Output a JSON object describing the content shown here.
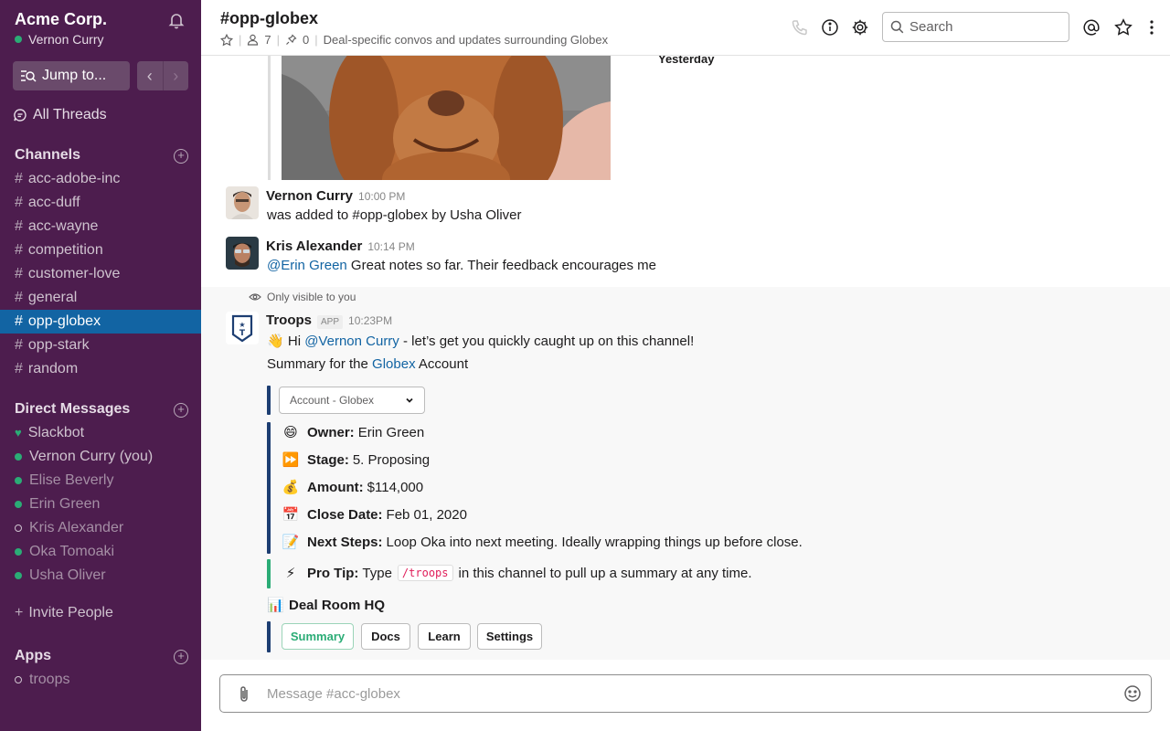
{
  "workspace": {
    "name": "Acme Corp.",
    "user": "Vernon Curry"
  },
  "sidebar": {
    "jump_label": "Jump to...",
    "threads_label": "All Threads",
    "channels_title": "Channels",
    "channels": [
      "acc-adobe-inc",
      "acc-duff",
      "acc-wayne",
      "competition",
      "customer-love",
      "general",
      "opp-globex",
      "opp-stark",
      "random"
    ],
    "active_channel": "opp-globex",
    "dm_title": "Direct Messages",
    "dms": [
      {
        "name": "Slackbot",
        "status": "bot"
      },
      {
        "name": "Vernon Curry  (you)",
        "status": "active"
      },
      {
        "name": "Elise Beverly",
        "status": "active-dim"
      },
      {
        "name": "Erin Green",
        "status": "active-dim"
      },
      {
        "name": "Kris Alexander",
        "status": "away"
      },
      {
        "name": "Oka Tomoaki",
        "status": "active-dim"
      },
      {
        "name": "Usha Oliver",
        "status": "active-dim"
      }
    ],
    "invite_label": "Invite People",
    "apps_title": "Apps",
    "apps": [
      "troops"
    ]
  },
  "header": {
    "channel": "#opp-globex",
    "members": "7",
    "pins": "0",
    "topic": "Deal-specific convos and updates surrounding Globex",
    "search_placeholder": "Search"
  },
  "feed": {
    "day_separator": "Yesterday",
    "messages": [
      {
        "author": "Vernon Curry",
        "time": "10:00 PM",
        "text": "was added to #opp-globex by Usha Oliver"
      },
      {
        "author": "Kris Alexander",
        "time": "10:14 PM",
        "mention": "@Erin Green",
        "text": " Great notes so far.  Their feedback encourages me"
      }
    ],
    "only_visible": "Only visible to you",
    "troops": {
      "author": "Troops",
      "badge": "APP",
      "time": "10:23PM",
      "greet_pre": "Hi ",
      "greet_mention": "@Vernon Curry",
      "greet_post": " - let’s get you quickly caught up on this channel!",
      "summary_pre": "Summary for the ",
      "summary_link": "Globex",
      "summary_post": " Account",
      "select_value": "Account - Globex",
      "fields": [
        {
          "emoji": "😄",
          "label": "Owner:",
          "value": "Erin Green"
        },
        {
          "emoji": "⏩",
          "label": "Stage:",
          "value": "5. Proposing"
        },
        {
          "emoji": "💰",
          "label": "Amount:",
          "value": "$114,000"
        },
        {
          "emoji": "📅",
          "label": "Close Date:",
          "value": "Feb 01, 2020"
        },
        {
          "emoji": "📝",
          "label": "Next Steps:",
          "value": "Loop Oka into next meeting.  Ideally wrapping things up before close."
        }
      ],
      "tip_label": "Pro Tip:",
      "tip_pre": "Type",
      "tip_code": "/troops",
      "tip_post": "in this channel to pull up a summary at any time.",
      "dealroom_title": "Deal Room HQ",
      "buttons": [
        "Summary",
        "Docs",
        "Learn",
        "Settings"
      ]
    }
  },
  "composer": {
    "placeholder": "Message #acc-globex"
  }
}
